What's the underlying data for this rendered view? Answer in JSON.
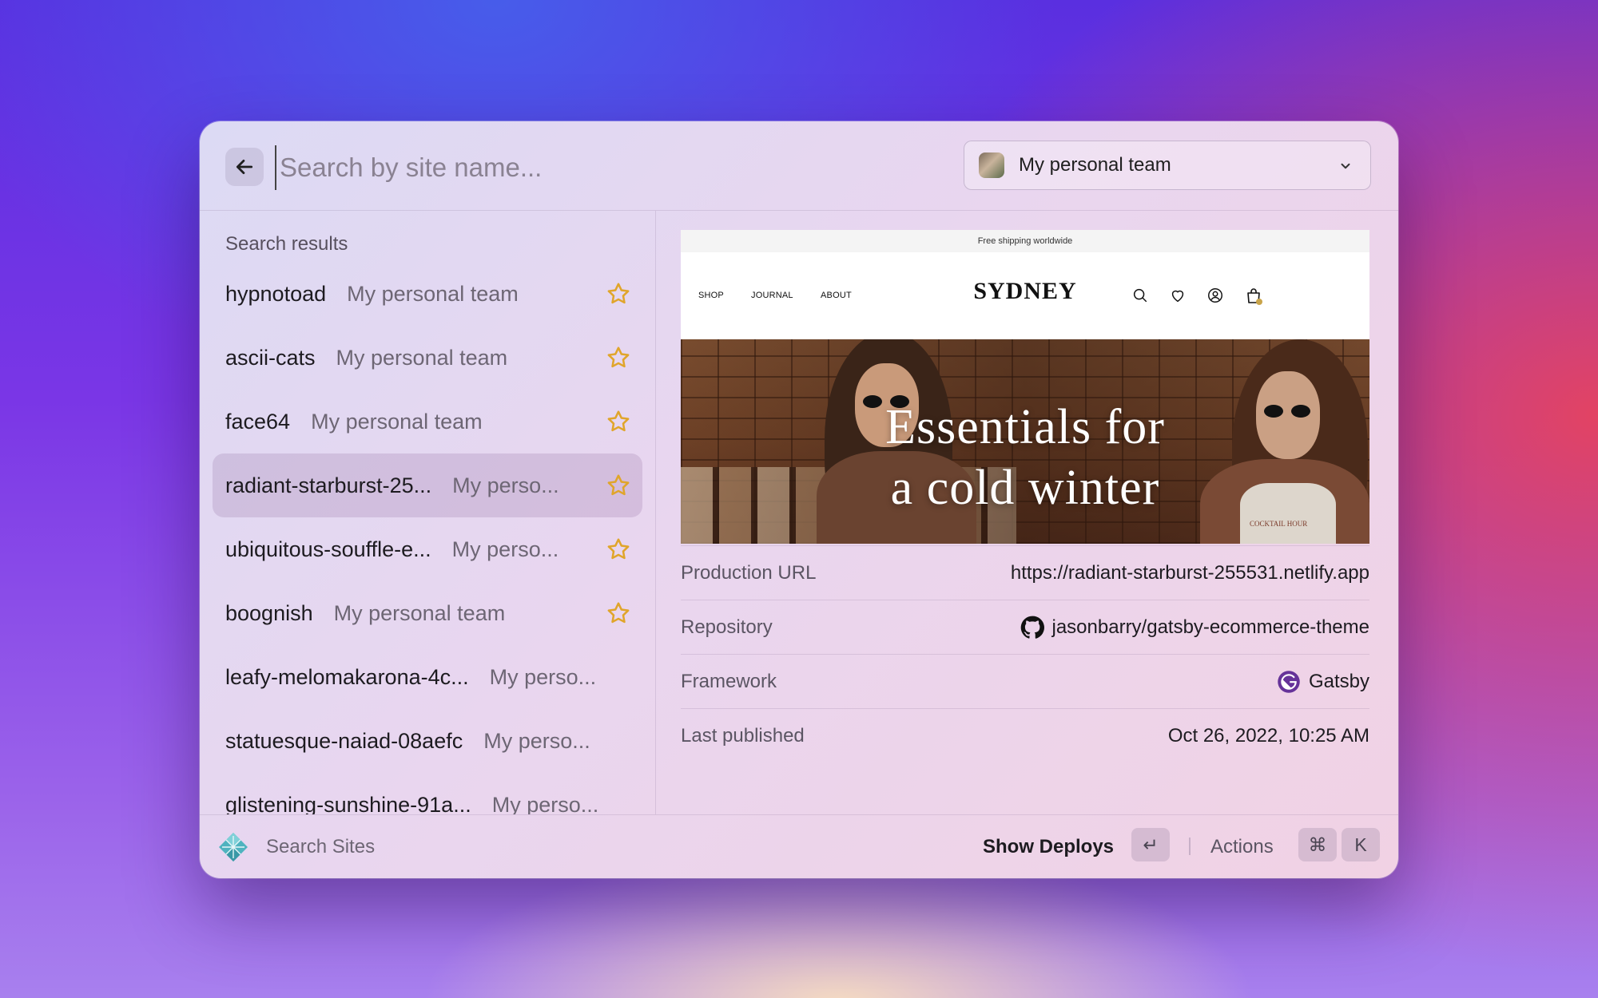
{
  "search": {
    "placeholder": "Search by site name..."
  },
  "team_selector": {
    "label": "My personal team"
  },
  "results": {
    "section_label": "Search results",
    "items": [
      {
        "name": "hypnotoad",
        "team": "My personal team",
        "starred": true
      },
      {
        "name": "ascii-cats",
        "team": "My personal team",
        "starred": true
      },
      {
        "name": "face64",
        "team": "My personal team",
        "starred": true
      },
      {
        "name": "radiant-starburst-25...",
        "team": "My perso...",
        "starred": true,
        "selected": true
      },
      {
        "name": "ubiquitous-souffle-e...",
        "team": "My perso...",
        "starred": true
      },
      {
        "name": "boognish",
        "team": "My personal team",
        "starred": true
      },
      {
        "name": "leafy-melomakarona-4c...",
        "team": "My perso...",
        "starred": false
      },
      {
        "name": "statuesque-naiad-08aefc",
        "team": "My perso...",
        "starred": false
      },
      {
        "name": "glistening-sunshine-91a...",
        "team": "My perso...",
        "starred": false
      }
    ]
  },
  "preview": {
    "shipping_banner": "Free shipping worldwide",
    "nav_links": [
      "SHOP",
      "JOURNAL",
      "ABOUT"
    ],
    "logo": "SYDNEY",
    "cart_count": "1",
    "hero_line1": "Essentials for",
    "hero_line2": "a cold winter",
    "shirt_text": "COCKTAIL HOUR"
  },
  "details": {
    "production_url": {
      "label": "Production URL",
      "value": "https://radiant-starburst-255531.netlify.app"
    },
    "repository": {
      "label": "Repository",
      "value": "jasonbarry/gatsby-ecommerce-theme",
      "icon": "github-icon"
    },
    "framework": {
      "label": "Framework",
      "value": "Gatsby",
      "icon": "gatsby-icon"
    },
    "last_published": {
      "label": "Last published",
      "value": "Oct 26, 2022, 10:25 AM"
    }
  },
  "footer": {
    "app_label": "Search Sites",
    "primary_action": "Show Deploys",
    "primary_shortcut": "↵",
    "actions_label": "Actions",
    "actions_shortcut_mod": "⌘",
    "actions_shortcut_key": "K"
  },
  "colors": {
    "star": "#e0a52a",
    "gatsby": "#663399"
  }
}
